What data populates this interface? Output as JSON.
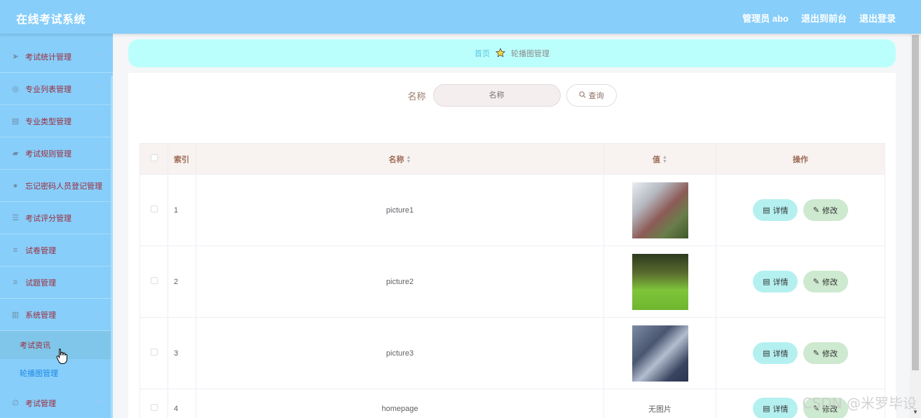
{
  "app": {
    "title": "在线考试系统"
  },
  "header": {
    "user": "管理员 abo",
    "to_front": "退出到前台",
    "logout": "退出登录"
  },
  "sidebar": {
    "items": [
      {
        "label": "考试统计管理",
        "icon": "send-icon"
      },
      {
        "label": "专业列表管理",
        "icon": "globe-icon"
      },
      {
        "label": "专业类型管理",
        "icon": "clipboard-icon"
      },
      {
        "label": "考试规则管理",
        "icon": "folder-icon"
      },
      {
        "label": "忘记密码人员登记管理",
        "icon": "user-icon"
      },
      {
        "label": "考试评分管理",
        "icon": "sliders-icon"
      },
      {
        "label": "试卷管理",
        "icon": "list-icon"
      },
      {
        "label": "试题管理",
        "icon": "list-icon"
      },
      {
        "label": "系统管理",
        "icon": "books-icon"
      }
    ],
    "subitems": [
      {
        "label": "考试资讯"
      },
      {
        "label": "轮播图管理"
      }
    ],
    "bottom_item": {
      "label": "考试管理",
      "icon": "edit-icon"
    }
  },
  "breadcrumb": {
    "home": "首页",
    "current": "轮播图管理"
  },
  "search": {
    "label": "名称",
    "placeholder": "名称",
    "button": "查询"
  },
  "table": {
    "headers": {
      "index": "索引",
      "name": "名称",
      "value": "值",
      "actions": "操作"
    },
    "rows": [
      {
        "index": "1",
        "name": "picture1",
        "image": "pic1"
      },
      {
        "index": "2",
        "name": "picture2",
        "image": "pic2"
      },
      {
        "index": "3",
        "name": "picture3",
        "image": "pic3"
      },
      {
        "index": "4",
        "name": "homepage",
        "value_text": "无图片"
      }
    ],
    "detail_label": "详情",
    "edit_label": "修改"
  },
  "watermark": "CSDN @米罗毕设"
}
